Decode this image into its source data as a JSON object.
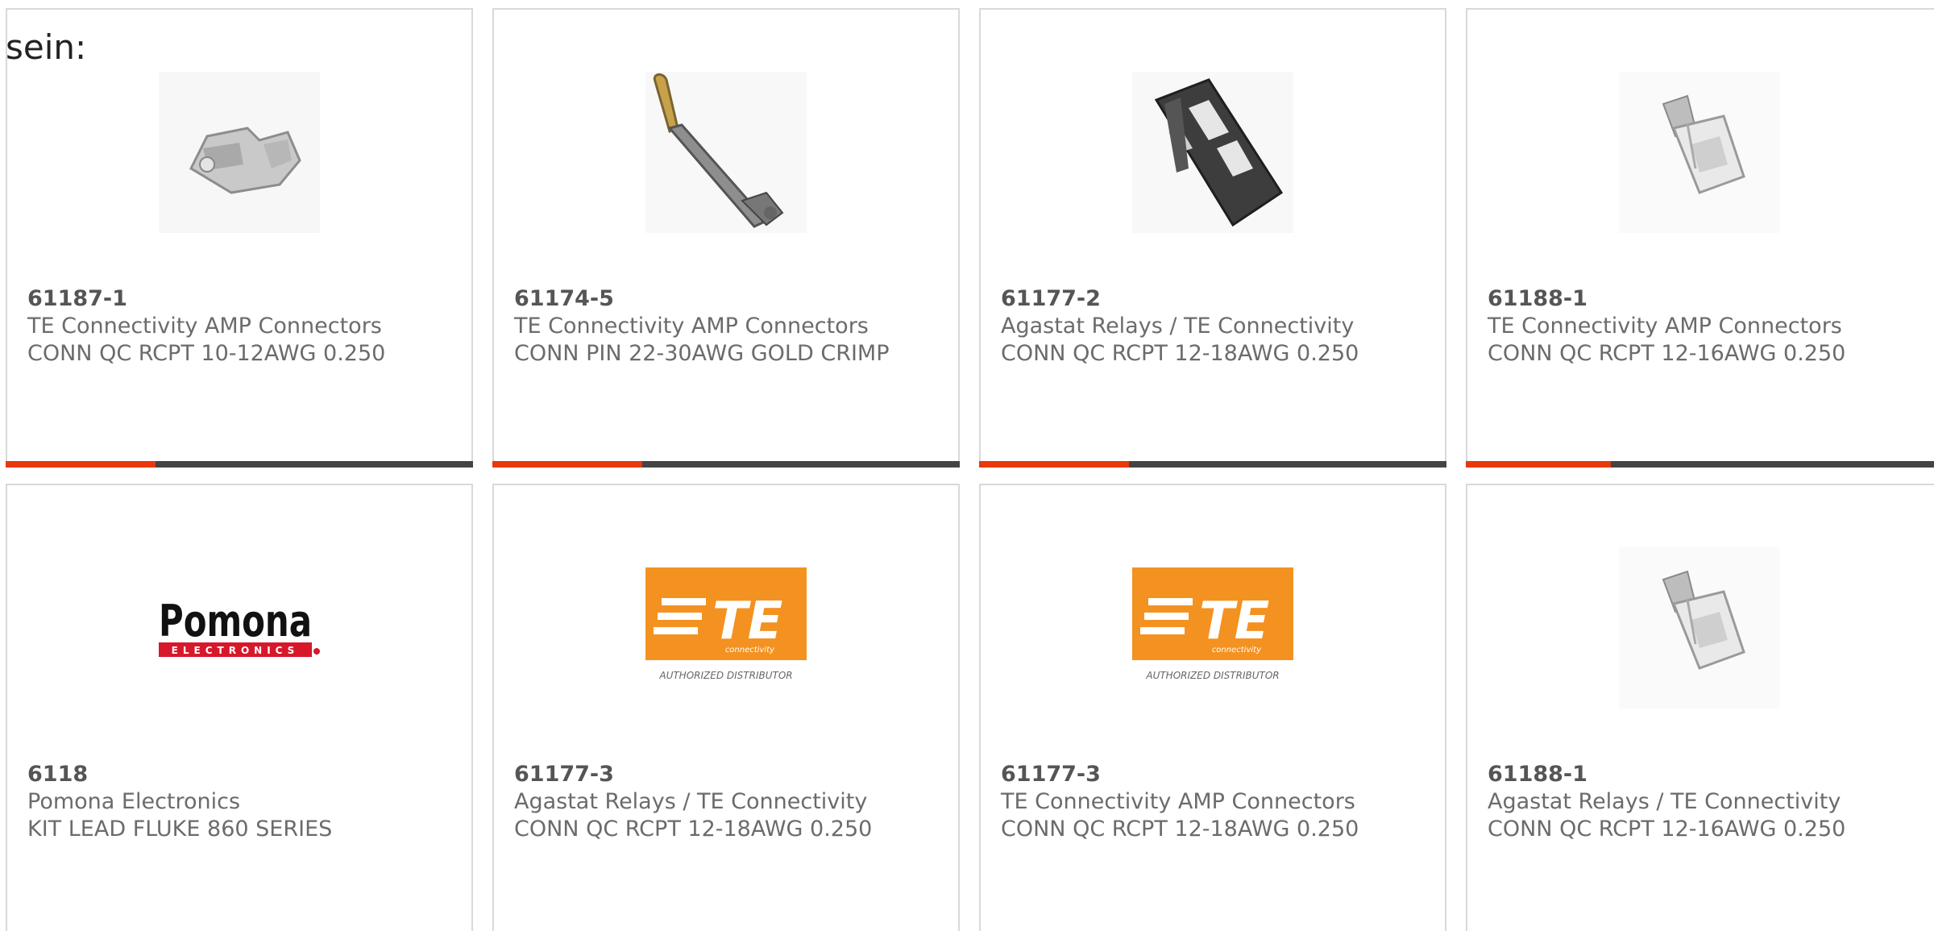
{
  "intro_text": "sein:",
  "colors": {
    "accent": "#e8380d",
    "bar_dark": "#444444",
    "border": "#d9d9d9",
    "te_orange": "#f39221",
    "pomona_red": "#d7182a"
  },
  "products": [
    {
      "part": "61187-1",
      "maker": "TE Connectivity AMP Connectors",
      "desc": "CONN QC RCPT 10-12AWG 0.250",
      "image": "receptacle-terminal-icon"
    },
    {
      "part": "61174-5",
      "maker": "TE Connectivity AMP Connectors",
      "desc": "CONN PIN 22-30AWG GOLD CRIMP",
      "image": "crimp-pin-icon"
    },
    {
      "part": "61177-2",
      "maker": "Agastat Relays / TE Connectivity",
      "desc": "CONN QC RCPT 12-18AWG 0.250",
      "image": "dark-receptacle-icon"
    },
    {
      "part": "61188-1",
      "maker": "TE Connectivity AMP Connectors",
      "desc": "CONN QC RCPT 12-16AWG 0.250",
      "image": "insulated-receptacle-icon"
    },
    {
      "part": "6118",
      "maker": "Pomona Electronics",
      "desc": "KIT LEAD FLUKE 860 SERIES",
      "image": "pomona-logo",
      "logo_text": "Pomona",
      "logo_sub": "ELECTRONICS"
    },
    {
      "part": "61177-3",
      "maker": "Agastat Relays / TE Connectivity",
      "desc": "CONN QC RCPT 12-18AWG 0.250",
      "image": "te-logo",
      "logo_text": "TE",
      "logo_sub": "connectivity",
      "logo_caption": "AUTHORIZED DISTRIBUTOR"
    },
    {
      "part": "61177-3",
      "maker": "TE Connectivity AMP Connectors",
      "desc": "CONN QC RCPT 12-18AWG 0.250",
      "image": "te-logo",
      "logo_text": "TE",
      "logo_sub": "connectivity",
      "logo_caption": "AUTHORIZED DISTRIBUTOR"
    },
    {
      "part": "61188-1",
      "maker": "Agastat Relays / TE Connectivity",
      "desc": "CONN QC RCPT 12-16AWG 0.250",
      "image": "insulated-receptacle-icon"
    }
  ]
}
